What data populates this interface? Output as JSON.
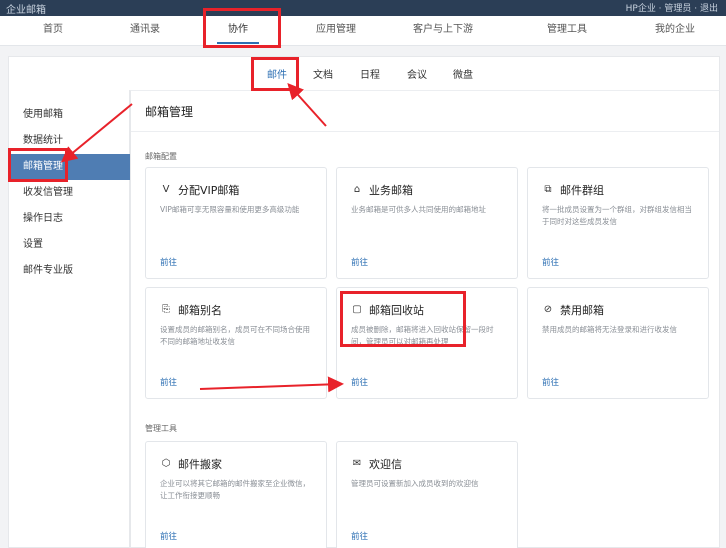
{
  "top_strip": {
    "left": "企业邮箱",
    "right": "HP企业 · 管理员 · 退出"
  },
  "main_nav": {
    "tabs": [
      {
        "label": "首页"
      },
      {
        "label": "通讯录"
      },
      {
        "label": "协作"
      },
      {
        "label": "应用管理"
      },
      {
        "label": "客户与上下游"
      },
      {
        "label": "管理工具"
      },
      {
        "label": "我的企业"
      }
    ],
    "active": "协作"
  },
  "sub_nav": {
    "tabs": [
      {
        "label": "邮件"
      },
      {
        "label": "文档"
      },
      {
        "label": "日程"
      },
      {
        "label": "会议"
      },
      {
        "label": "微盘"
      }
    ],
    "active": "邮件"
  },
  "sidebar": {
    "items": [
      {
        "label": "使用邮箱"
      },
      {
        "label": "数据统计"
      },
      {
        "label": "邮箱管理"
      },
      {
        "label": "收发信管理"
      },
      {
        "label": "操作日志"
      },
      {
        "label": "设置"
      },
      {
        "label": "邮件专业版"
      }
    ],
    "active": "邮箱管理"
  },
  "page": {
    "title": "邮箱管理",
    "section_config": "邮箱配置",
    "section_tools": "管理工具",
    "go_label": "前往"
  },
  "cards": [
    {
      "icon": "vip-icon",
      "title": "分配VIP邮箱",
      "desc": "VIP邮箱可享无限容量和使用更多高级功能"
    },
    {
      "icon": "business-mail-icon",
      "title": "业务邮箱",
      "desc": "业务邮箱是可供多人共同使用的邮箱地址"
    },
    {
      "icon": "mail-group-icon",
      "title": "邮件群组",
      "desc": "将一批成员设置为一个群组，对群组发信相当于同时对这些成员发信"
    },
    {
      "icon": "alias-icon",
      "title": "邮箱别名",
      "desc": "设置成员的邮箱别名，成员可在不同场合使用不同的邮箱地址收发信"
    },
    {
      "icon": "recycle-bin-icon",
      "title": "邮箱回收站",
      "desc": "成员被删除，邮箱将进入回收站保留一段时间，管理员可以对邮箱再处理"
    },
    {
      "icon": "ban-icon",
      "title": "禁用邮箱",
      "desc": "禁用成员的邮箱将无法登录和进行收发信"
    }
  ],
  "tool_cards": [
    {
      "icon": "mail-move-icon",
      "title": "邮件搬家",
      "desc": "企业可以将其它邮箱的邮件搬家至企业微信，让工作衔接更顺畅"
    },
    {
      "icon": "welcome-letter-icon",
      "title": "欢迎信",
      "desc": "管理员可设置新加入成员收到的欢迎信"
    }
  ],
  "colors": {
    "accent": "#2c6fb3",
    "highlight": "#e8222a",
    "sidebar_active": "#4f7db3"
  }
}
